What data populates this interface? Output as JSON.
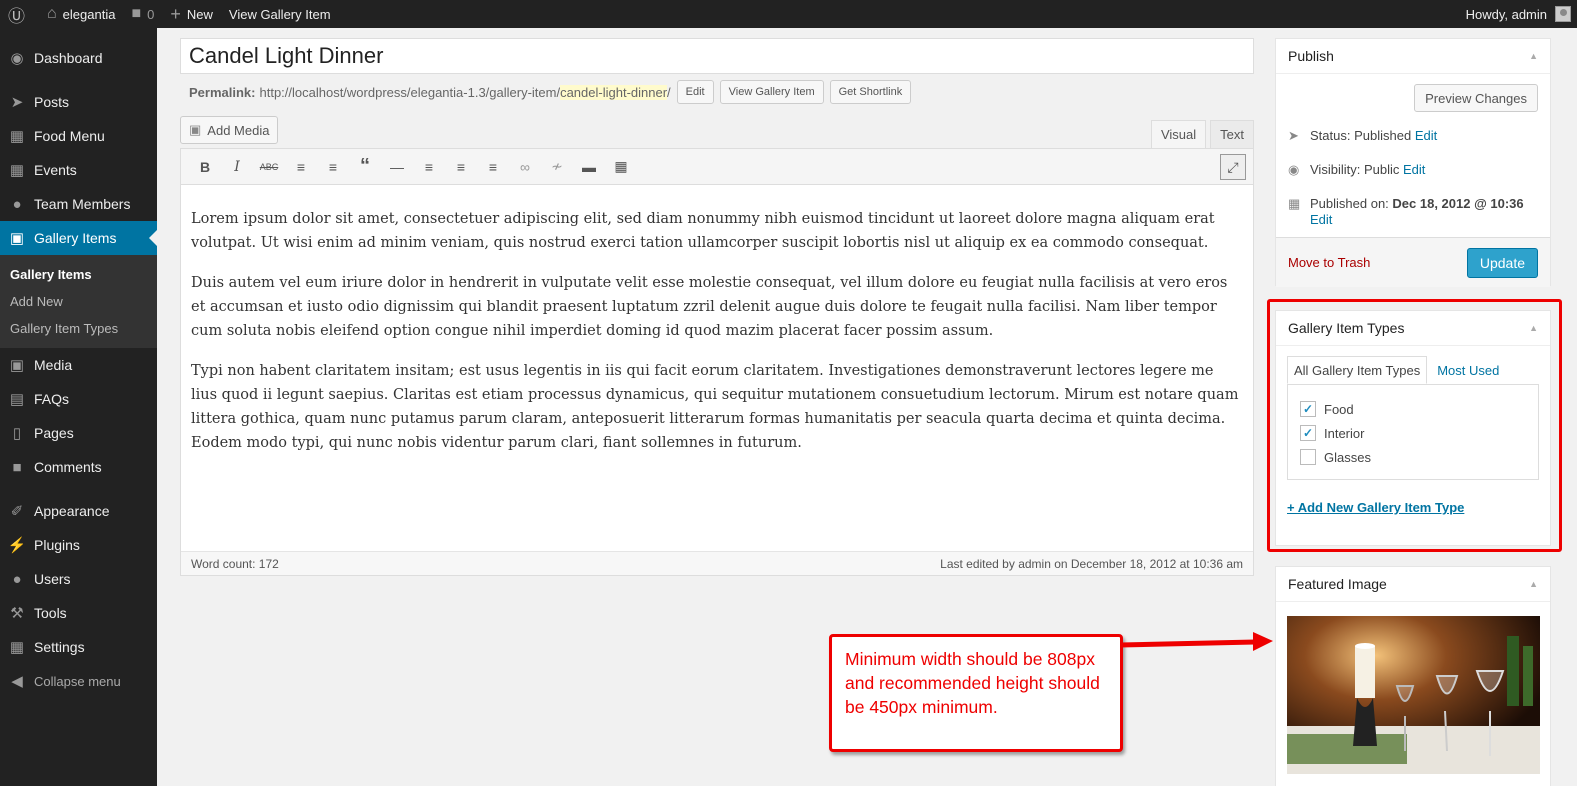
{
  "adminbar": {
    "site_name": "elegantia",
    "comments_count": "0",
    "new_label": "New",
    "view_label": "View Gallery Item",
    "howdy": "Howdy, admin"
  },
  "menu": {
    "dashboard": "Dashboard",
    "posts": "Posts",
    "food_menu": "Food Menu",
    "events": "Events",
    "team_members": "Team Members",
    "gallery_items": "Gallery Items",
    "sub": [
      "Gallery Items",
      "Add New",
      "Gallery Item Types"
    ],
    "media": "Media",
    "faqs": "FAQs",
    "pages": "Pages",
    "comments": "Comments",
    "appearance": "Appearance",
    "plugins": "Plugins",
    "users": "Users",
    "tools": "Tools",
    "settings": "Settings",
    "collapse": "Collapse menu"
  },
  "post": {
    "title": "Candel Light Dinner",
    "permalink_label": "Permalink:",
    "permalink_base": "http://localhost/wordpress/elegantia-1.3/gallery-item/",
    "permalink_slug": "candel-light-dinner",
    "permalink_end": "/",
    "edit_btn": "Edit",
    "view_btn": "View Gallery Item",
    "shortlink_btn": "Get Shortlink"
  },
  "editor": {
    "add_media": "Add Media",
    "tab_visual": "Visual",
    "tab_text": "Text",
    "paragraphs": [
      "Lorem ipsum dolor sit amet, consectetuer adipiscing elit, sed diam nonummy nibh euismod tincidunt ut laoreet dolore magna aliquam erat volutpat. Ut wisi enim ad minim veniam, quis nostrud exerci tation ullamcorper suscipit lobortis nisl ut aliquip ex ea commodo consequat.",
      "Duis autem vel eum iriure dolor in hendrerit in vulputate velit esse molestie consequat, vel illum dolore eu feugiat nulla facilisis at vero eros et accumsan et iusto odio dignissim qui blandit praesent luptatum zzril delenit augue duis dolore te feugait nulla facilisi. Nam liber tempor cum soluta nobis eleifend option congue nihil imperdiet doming id quod mazim placerat facer possim assum.",
      "Typi non habent claritatem insitam; est usus legentis in iis qui facit eorum claritatem. Investigationes demonstraverunt lectores legere me lius quod ii legunt saepius. Claritas est etiam processus dynamicus, qui sequitur mutationem consuetudium lectorum. Mirum est notare quam littera gothica, quam nunc putamus parum claram, anteposuerit litterarum formas humanitatis per seacula quarta decima et quinta decima. Eodem modo typi, qui nunc nobis videntur parum clari, fiant sollemnes in futurum."
    ],
    "word_count": "Word count: 172",
    "last_edited": "Last edited by admin on December 18, 2012 at 10:36 am"
  },
  "publish": {
    "title": "Publish",
    "preview": "Preview Changes",
    "status_label": "Status:",
    "status_value": "Published",
    "visibility_label": "Visibility:",
    "visibility_value": "Public",
    "published_label": "Published on:",
    "published_value": "Dec 18, 2012 @ 10:36",
    "edit": "Edit",
    "trash": "Move to Trash",
    "update": "Update"
  },
  "types": {
    "title": "Gallery Item Types",
    "tab_all": "All Gallery Item Types",
    "tab_most": "Most Used",
    "items": [
      {
        "label": "Food",
        "checked": true
      },
      {
        "label": "Interior",
        "checked": true
      },
      {
        "label": "Glasses",
        "checked": false
      }
    ],
    "add_new": "+ Add New Gallery Item Type"
  },
  "featured": {
    "title": "Featured Image"
  },
  "callout": {
    "text": "Minimum width should be 808px and recommended height should be 450px minimum."
  },
  "colors": {
    "accent": "#0074a2",
    "annotation": "#ee0000",
    "admin_bg": "#222222"
  }
}
